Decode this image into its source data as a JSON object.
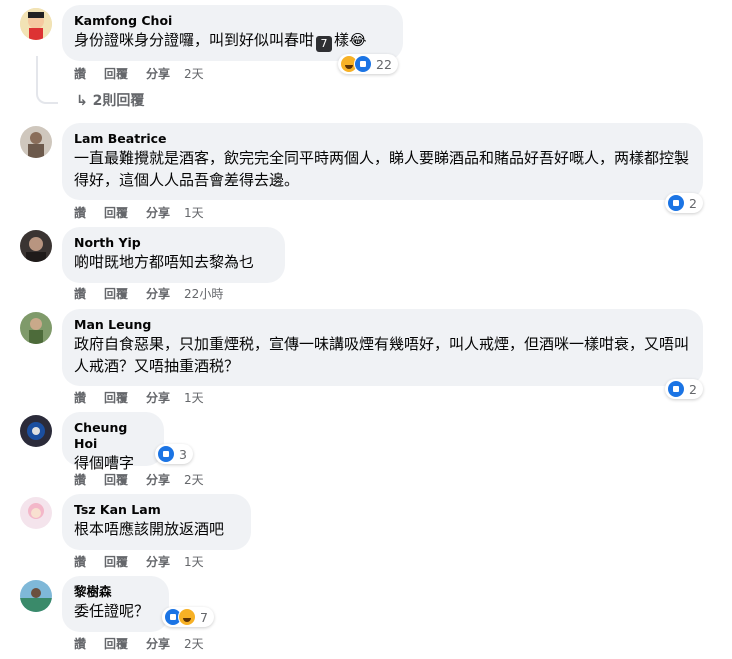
{
  "actions": {
    "like": "讚",
    "reply": "回覆",
    "share": "分享"
  },
  "comments": [
    {
      "author": "Kamfong Choi",
      "text_before": "身份證咪身分證囉，叫到好似叫春咁",
      "emoji": "7",
      "text_after": "樣😂",
      "time": "2天",
      "reaction_count": "22",
      "replies": "2則回覆"
    },
    {
      "author": "Lam Beatrice",
      "text": "一直最難攪就是酒客，飲完完全同平時两個人，睇人要睇酒品和賭品好吾好嘅人，两樣都控製得好，這個人人品吾會差得去邊。",
      "time": "1天",
      "reaction_count": "2"
    },
    {
      "author": "North Yip",
      "text": "啲咁既地方都唔知去黎為乜",
      "time": "22小時"
    },
    {
      "author": "Man Leung",
      "text": "政府自食惡果，只加重煙税，宣傳一味講吸煙有幾唔好，叫人戒煙，但酒咪一樣咁衰，又唔叫人戒酒？又唔抽重酒税？",
      "time": "1天",
      "reaction_count": "2"
    },
    {
      "author": "Cheung Hoi",
      "text": "得個嘈字",
      "time": "2天",
      "reaction_count": "3"
    },
    {
      "author": "Tsz Kan Lam",
      "text": "根本唔應該開放返酒吧",
      "time": "1天"
    },
    {
      "author": "黎樹森",
      "text": "委任證呢？",
      "time": "2天",
      "reaction_count": "7"
    }
  ],
  "colors": {
    "bubble": "#f0f2f5",
    "like": "#1b74e4",
    "haha": "#f7b125",
    "meta": "#65676b"
  }
}
